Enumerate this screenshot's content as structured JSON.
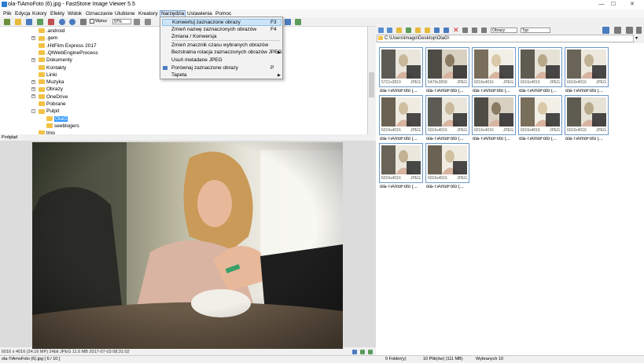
{
  "window": {
    "title": "ola-TiAmoFoto (6).jpg - FastStone Image Viewer 5.5",
    "minimize": "—",
    "maximize": "☐",
    "close": "✕"
  },
  "menubar": [
    "Plik",
    "Edycja",
    "Kolory",
    "Efekty",
    "Widok",
    "Oznaczanie",
    "Ulubione",
    "Kreatory",
    "Narzędzia",
    "Ustawienia",
    "Pomoc"
  ],
  "toolbar": {
    "fit_label": "Wpisz",
    "zoom_value": "97%"
  },
  "dropdown": {
    "items": [
      {
        "label": "Konwertuj zaznaczone obrazy",
        "shortcut": "F3",
        "highlighted": true
      },
      {
        "label": "Zmień nazwę zaznaczonych obrazów",
        "shortcut": "F4"
      },
      {
        "label": "Zmiana / Konwersja",
        "shortcut": ""
      },
      {
        "label": "Zmień znacznik czasu wybranych obrazów",
        "shortcut": ""
      },
      {
        "label": "Bezstratna rotacja zaznaczonych obrazów JPEG",
        "shortcut": "",
        "submenu": true
      },
      {
        "label": "Usuń metadane JPEG",
        "shortcut": ""
      },
      {
        "label": "Porównaj zaznaczone obrazy",
        "shortcut": "P"
      },
      {
        "label": "Tapeta",
        "shortcut": "",
        "submenu": true
      }
    ]
  },
  "tree": [
    {
      "label": ".android",
      "depth": 0,
      "expander": ""
    },
    {
      "label": ".gem",
      "depth": 0,
      "expander": "+"
    },
    {
      "label": ".HitFilm Express 2017",
      "depth": 0,
      "expander": ""
    },
    {
      "label": ".QtWebEngineProcess",
      "depth": 0,
      "expander": ""
    },
    {
      "label": "Dokumenty",
      "depth": 0,
      "expander": "+"
    },
    {
      "label": "Kontakty",
      "depth": 0,
      "expander": ""
    },
    {
      "label": "Linki",
      "depth": 0,
      "expander": ""
    },
    {
      "label": "Muzyka",
      "depth": 0,
      "expander": "+"
    },
    {
      "label": "Obrazy",
      "depth": 0,
      "expander": "+"
    },
    {
      "label": "OneDrive",
      "depth": 0,
      "expander": "+"
    },
    {
      "label": "Pobrane",
      "depth": 0,
      "expander": ""
    },
    {
      "label": "Pulpit",
      "depth": 0,
      "expander": "-"
    },
    {
      "label": "OlaG",
      "depth": 1,
      "expander": "",
      "selected": true
    },
    {
      "label": "seeblogers",
      "depth": 1,
      "expander": ""
    },
    {
      "label": "tmp",
      "depth": 0,
      "expander": ""
    }
  ],
  "preview": {
    "label": "Podgląd",
    "info": "6016 x 4016 (24.16 MP)  24bit  JPEG  11.6 MB  2017-07-03 08:31:02"
  },
  "right": {
    "filter": "Obrazy",
    "sort": "Typ",
    "path": "C:\\Users\\imago\\Desktop\\OlaG\\"
  },
  "thumbnails": [
    {
      "res": "5721x3819",
      "fmt": "JPEG",
      "name": "ola-TiAmoFoto (..."
    },
    {
      "res": "5479x3658",
      "fmt": "JPEG",
      "name": "ola-TiAmoFoto (..."
    },
    {
      "res": "6016x4016",
      "fmt": "JPEG",
      "name": "ola-TiAmoFoto (..."
    },
    {
      "res": "6016x4016",
      "fmt": "JPEG",
      "name": "ola-TiAmoFoto (..."
    },
    {
      "res": "6016x4016",
      "fmt": "JPEG",
      "name": "ola-TiAmoFoto (..."
    },
    {
      "res": "6016x4016",
      "fmt": "JPEG",
      "name": "ola-TiAmoFoto (..."
    },
    {
      "res": "6016x4016",
      "fmt": "JPEG",
      "name": "ola-TiAmoFoto (..."
    },
    {
      "res": "6016x4016",
      "fmt": "JPEG",
      "name": "ola-TiAmoFoto (..."
    },
    {
      "res": "6016x4016",
      "fmt": "JPEG",
      "name": "ola-TiAmoFoto (..."
    },
    {
      "res": "6016x4016",
      "fmt": "JPEG",
      "name": "ola-TiAmoFoto (..."
    },
    {
      "res": "6016x4016",
      "fmt": "JPEG",
      "name": "ola-TiAmoFoto (..."
    },
    {
      "res": "6016x4016",
      "fmt": "JPEG",
      "name": "ola-TiAmoFoto (..."
    }
  ],
  "status": {
    "file": "ola-TiAmoFoto (6).jpg [ 6 / 10 ]",
    "folders": "0 Folder(y)",
    "files": "10 Plik(ów) (111 MB)",
    "selected": "Wybranych 10"
  }
}
